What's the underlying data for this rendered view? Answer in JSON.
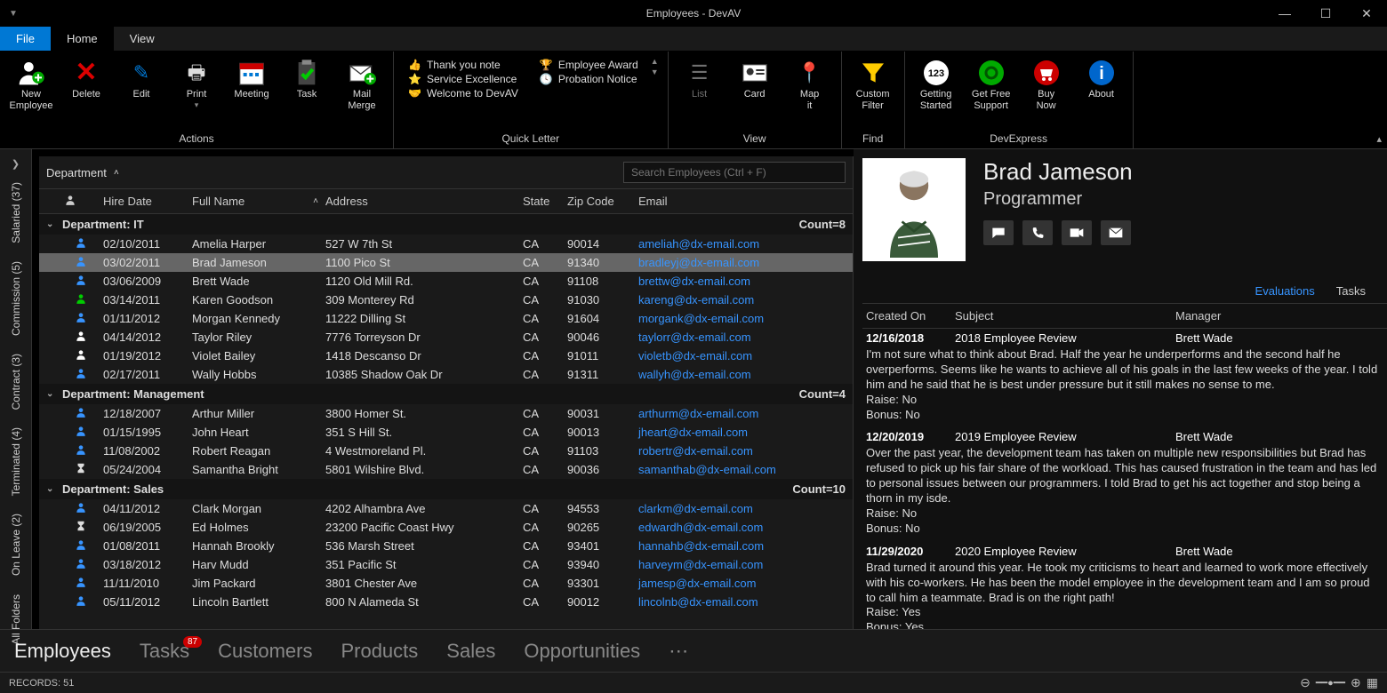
{
  "window": {
    "title": "Employees - DevAV"
  },
  "menu": {
    "file": "File",
    "home": "Home",
    "view": "View"
  },
  "ribbon": {
    "new_employee": "New\nEmployee",
    "delete": "Delete",
    "edit": "Edit",
    "print": "Print",
    "meeting": "Meeting",
    "task": "Task",
    "mail_merge": "Mail\nMerge",
    "actions_label": "Actions",
    "ql_thank": "Thank you note",
    "ql_award": "Employee Award",
    "ql_service": "Service Excellence",
    "ql_probation": "Probation Notice",
    "ql_welcome": "Welcome to DevAV",
    "quick_letter_label": "Quick Letter",
    "list": "List",
    "card": "Card",
    "map_it": "Map\nit",
    "view_label": "View",
    "custom_filter": "Custom\nFilter",
    "find_label": "Find",
    "getting_started": "Getting\nStarted",
    "get_free": "Get Free\nSupport",
    "buy_now": "Buy\nNow",
    "about": "About",
    "devexpress_label": "DevExpress"
  },
  "sidebar": {
    "items": [
      "Salaried (37)",
      "Commission (5)",
      "Contract (3)",
      "Terminated (4)",
      "On Leave (2)",
      "All Folders"
    ]
  },
  "grid": {
    "group_by": "Department",
    "search_placeholder": "Search Employees (Ctrl + F)",
    "headers": {
      "hire_date": "Hire Date",
      "full_name": "Full Name",
      "address": "Address",
      "state": "State",
      "zip": "Zip Code",
      "email": "Email"
    },
    "groups": [
      {
        "name": "Department: IT",
        "count": "Count=8",
        "rows": [
          {
            "icon": "blue",
            "hire": "02/10/2011",
            "name": "Amelia Harper",
            "addr": "527 W 7th St",
            "state": "CA",
            "zip": "90014",
            "email": "ameliah@dx-email.com"
          },
          {
            "icon": "blue",
            "hire": "03/02/2011",
            "name": "Brad Jameson",
            "addr": "1100 Pico St",
            "state": "CA",
            "zip": "91340",
            "email": "bradleyj@dx-email.com",
            "selected": true
          },
          {
            "icon": "blue",
            "hire": "03/06/2009",
            "name": "Brett Wade",
            "addr": "1120 Old Mill Rd.",
            "state": "CA",
            "zip": "91108",
            "email": "brettw@dx-email.com"
          },
          {
            "icon": "green",
            "hire": "03/14/2011",
            "name": "Karen Goodson",
            "addr": "309 Monterey Rd",
            "state": "CA",
            "zip": "91030",
            "email": "kareng@dx-email.com"
          },
          {
            "icon": "blue",
            "hire": "01/11/2012",
            "name": "Morgan Kennedy",
            "addr": "11222 Dilling St",
            "state": "CA",
            "zip": "91604",
            "email": "morgank@dx-email.com"
          },
          {
            "icon": "white",
            "hire": "04/14/2012",
            "name": "Taylor Riley",
            "addr": "7776 Torreyson Dr",
            "state": "CA",
            "zip": "90046",
            "email": "taylorr@dx-email.com"
          },
          {
            "icon": "white",
            "hire": "01/19/2012",
            "name": "Violet Bailey",
            "addr": "1418 Descanso Dr",
            "state": "CA",
            "zip": "91011",
            "email": "violetb@dx-email.com"
          },
          {
            "icon": "blue",
            "hire": "02/17/2011",
            "name": "Wally Hobbs",
            "addr": "10385 Shadow Oak Dr",
            "state": "CA",
            "zip": "91311",
            "email": "wallyh@dx-email.com"
          }
        ]
      },
      {
        "name": "Department: Management",
        "count": "Count=4",
        "rows": [
          {
            "icon": "blue",
            "hire": "12/18/2007",
            "name": "Arthur Miller",
            "addr": "3800 Homer St.",
            "state": "CA",
            "zip": "90031",
            "email": "arthurm@dx-email.com"
          },
          {
            "icon": "blue",
            "hire": "01/15/1995",
            "name": "John Heart",
            "addr": "351 S Hill St.",
            "state": "CA",
            "zip": "90013",
            "email": "jheart@dx-email.com"
          },
          {
            "icon": "blue",
            "hire": "11/08/2002",
            "name": "Robert Reagan",
            "addr": "4 Westmoreland Pl.",
            "state": "CA",
            "zip": "91103",
            "email": "robertr@dx-email.com"
          },
          {
            "icon": "hourglass",
            "hire": "05/24/2004",
            "name": "Samantha Bright",
            "addr": "5801 Wilshire Blvd.",
            "state": "CA",
            "zip": "90036",
            "email": "samanthab@dx-email.com"
          }
        ]
      },
      {
        "name": "Department: Sales",
        "count": "Count=10",
        "rows": [
          {
            "icon": "blue",
            "hire": "04/11/2012",
            "name": "Clark Morgan",
            "addr": "4202 Alhambra Ave",
            "state": "CA",
            "zip": "94553",
            "email": "clarkm@dx-email.com"
          },
          {
            "icon": "hourglass",
            "hire": "06/19/2005",
            "name": "Ed Holmes",
            "addr": "23200 Pacific Coast Hwy",
            "state": "CA",
            "zip": "90265",
            "email": "edwardh@dx-email.com"
          },
          {
            "icon": "blue",
            "hire": "01/08/2011",
            "name": "Hannah Brookly",
            "addr": "536 Marsh Street",
            "state": "CA",
            "zip": "93401",
            "email": "hannahb@dx-email.com"
          },
          {
            "icon": "blue",
            "hire": "03/18/2012",
            "name": "Harv Mudd",
            "addr": "351 Pacific St",
            "state": "CA",
            "zip": "93940",
            "email": "harveym@dx-email.com"
          },
          {
            "icon": "blue",
            "hire": "11/11/2010",
            "name": "Jim Packard",
            "addr": "3801 Chester Ave",
            "state": "CA",
            "zip": "93301",
            "email": "jamesp@dx-email.com"
          },
          {
            "icon": "blue",
            "hire": "05/11/2012",
            "name": "Lincoln Bartlett",
            "addr": "800 N Alameda St",
            "state": "CA",
            "zip": "90012",
            "email": "lincolnb@dx-email.com"
          }
        ]
      }
    ]
  },
  "detail": {
    "name": "Brad Jameson",
    "title": "Programmer",
    "tabs": {
      "eval": "Evaluations",
      "tasks": "Tasks"
    },
    "eval_headers": {
      "created": "Created On",
      "subject": "Subject",
      "manager": "Manager"
    },
    "evals": [
      {
        "date": "12/16/2018",
        "subject": "2018 Employee Review",
        "manager": "Brett Wade",
        "text": "I'm not sure what to think about Brad. Half the year he underperforms and the second half he overperforms. Seems like he wants to achieve all of his goals in the last few weeks of the year. I told him and he said that he is best under pressure but it still makes no sense to me.",
        "raise": "Raise: No",
        "bonus": "Bonus: No"
      },
      {
        "date": "12/20/2019",
        "subject": "2019 Employee Review",
        "manager": "Brett Wade",
        "text": "Over the past year, the development team has taken on multiple new responsibilities but Brad has refused to pick up his fair share of the workload. This has caused frustration in the team and has led to personal issues between our programmers. I told Brad to get his act together and stop being a thorn in my isde.",
        "raise": "Raise: No",
        "bonus": "Bonus: No"
      },
      {
        "date": "11/29/2020",
        "subject": "2020 Employee Review",
        "manager": "Brett Wade",
        "text": "Brad turned it around this year. He took my criticisms to heart and learned to work more effectively with his co-workers. He has been the model employee in the development team and I am so proud to call him a teammate. Brad is on the right path!",
        "raise": "Raise: Yes",
        "bonus": "Bonus: Yes"
      }
    ]
  },
  "bottom": {
    "employees": "Employees",
    "tasks": "Tasks",
    "tasks_badge": "87",
    "customers": "Customers",
    "products": "Products",
    "sales": "Sales",
    "opportunities": "Opportunities"
  },
  "status": {
    "records": "RECORDS: 51"
  }
}
